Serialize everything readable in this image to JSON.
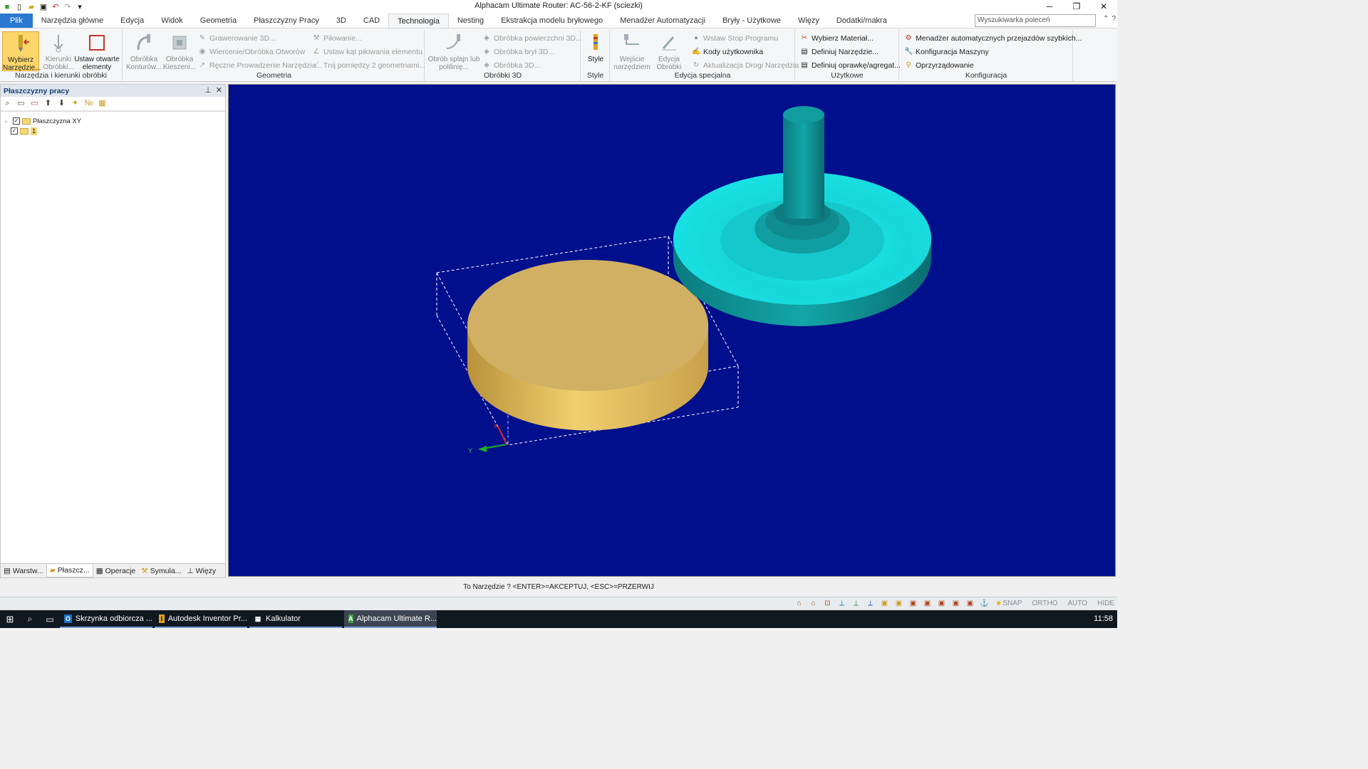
{
  "window": {
    "title": "Alphacam Ultimate Router: AC-56-2-KF (sciezki)",
    "controls": [
      "─",
      "❐",
      "✕"
    ]
  },
  "menu": {
    "tabs": [
      "Plik",
      "Narzędzia główne",
      "Edycja",
      "Widok",
      "Geometria",
      "Płaszczyzny Pracy",
      "3D",
      "CAD",
      "Technologia",
      "Nesting",
      "Ekstrakcja modelu bryłowego",
      "Menadżer Automatyzacji",
      "Bryły - Użytkowe",
      "Więzy",
      "Dodatki/makra"
    ],
    "active_tab": "Technologia",
    "search_placeholder": "Wyszukiwarka poleceń"
  },
  "ribbon": {
    "groups": {
      "tools": {
        "label": "Narzędzia i kierunki obróbki",
        "select_tool": "Wybierz Narzędzie...",
        "directions": "Kierunki Obróbki...",
        "open_elements": "Ustaw otwarte elementy"
      },
      "geometry": {
        "label": "Geometria",
        "contour": "Obróbka Konturów...",
        "pocket": "Obróbka Kieszeni...",
        "engrave3d": "Grawerowanie 3D...",
        "drilling": "Wiercenie/Obróbka Otworów",
        "manual": "Ręczne Prowadzenie Narzędzia...",
        "sawing": "Piłowanie...",
        "saw_angle": "Ustaw kąt piłowania elementu",
        "cut_between": "Tnij pomiędzy 2 geometriami..."
      },
      "machining3d": {
        "label": "Obróbki 3D",
        "spline": "Obrób splajn lub polilinię...",
        "surface3d": "Obróbka powierzchni 3D...",
        "solids3d": "Obróbka brył 3D...",
        "machining3d": "Obróbka 3D..."
      },
      "style": {
        "label": "Style",
        "style": "Style"
      },
      "special": {
        "label": "Edycja specjalna",
        "tool_entry": "Wejście narzędziem",
        "edit_machining": "Edycja Obróbki",
        "insert_stop": "Wstaw Stop Programu",
        "user_codes": "Kody użytkownika",
        "update_path": "Aktualizacja Drogi Narzędzia"
      },
      "utility": {
        "label": "Użytkowe",
        "select_material": "Wybierz Materiał...",
        "define_tool": "Definiuj Narzędzie...",
        "define_holder": "Definiuj oprawkę/agregat..."
      },
      "config": {
        "label": "Konfiguracja",
        "rapid_manager": "Menadżer automatycznych przejazdów szybkich...",
        "machine_config": "Konfiguracja Maszyny",
        "fixtures": "Oprzyrządowanie"
      }
    }
  },
  "panel": {
    "title": "Płaszczyzny pracy",
    "tree": [
      {
        "label": "Płaszczyzna XY"
      },
      {
        "label": "1"
      }
    ],
    "tabs": [
      "Warstw...",
      "Płaszcz...",
      "Operacje",
      "Symula...",
      "Więzy"
    ],
    "active_tab": "Płaszcz..."
  },
  "viewport": {
    "background": "#000f8c",
    "workpiece_color": "#e8c266",
    "tool_color": "#1fe6e8",
    "tool_shaft_color": "#0f7f80",
    "axis_labels": {
      "y": "Y",
      "x": "X"
    }
  },
  "prompt": {
    "text": "To Narzędzie ? <ENTER>=AKCEPTUJ, <ESC>=PRZERWIJ"
  },
  "status": {
    "modes": [
      "SNAP",
      "ORTHO",
      "AUTO",
      "HIDE"
    ]
  },
  "taskbar": {
    "apps": [
      {
        "label": "Skrzynka odbiorcza ...",
        "icon": "O"
      },
      {
        "label": "Autodesk Inventor Pr...",
        "icon": "I"
      },
      {
        "label": "Kalkulator",
        "icon": "▦"
      },
      {
        "label": "Alphacam Ultimate R...",
        "icon": "A"
      }
    ],
    "clock": "11:58"
  }
}
